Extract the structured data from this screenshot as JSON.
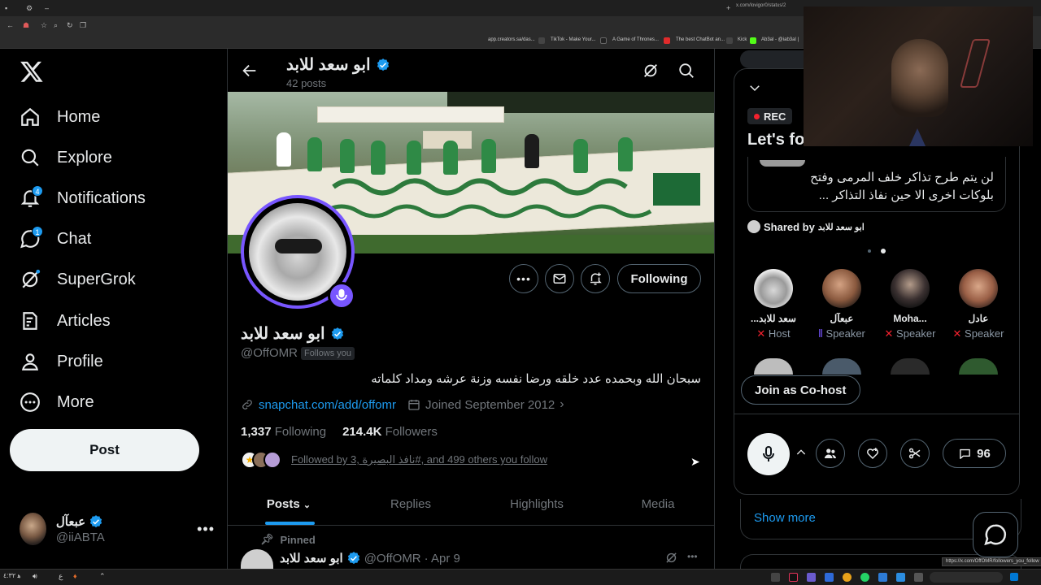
{
  "browser": {
    "url": "x.com/lovigor0/status/2",
    "status_url": "https://x.com/OffOMR/followers_you_follow",
    "bookmarks": [
      "app.creators.sa/das...",
      "TikTok - Make Your...",
      "A Game of Thrones...",
      "The best ChatBot an...",
      "Kick",
      "Ab3al - @iab3al |"
    ]
  },
  "nav": {
    "items": [
      {
        "label": "Home",
        "icon": "home-icon"
      },
      {
        "label": "Explore",
        "icon": "search-icon"
      },
      {
        "label": "Notifications",
        "icon": "bell-icon",
        "badge": "4"
      },
      {
        "label": "Chat",
        "icon": "chat-icon",
        "badge": "1"
      },
      {
        "label": "SuperGrok",
        "icon": "grok-icon"
      },
      {
        "label": "Articles",
        "icon": "article-icon"
      },
      {
        "label": "Profile",
        "icon": "person-icon"
      },
      {
        "label": "More",
        "icon": "more-icon"
      }
    ],
    "post_label": "Post",
    "account": {
      "name": "عبعآل",
      "handle": "@iiABTA"
    }
  },
  "header": {
    "name": "ابو سعد للابد",
    "posts_count": "42 posts"
  },
  "profile": {
    "name": "ابو سعد للابد",
    "handle": "@OffOMR",
    "follows_you": "Follows you",
    "bio": "سبحان الله وبحمده عدد خلقه ورضا نفسه وزنة عرشه ومداد كلماته",
    "link": "snapchat.com/add/offomr",
    "joined": "Joined September 2012",
    "following_count": "1,337",
    "following_label": "Following",
    "followers_count": "214.4K",
    "followers_label": "Followers",
    "followed_by": "Followed by 3, نافذ البصيرة#, and 499 others you follow",
    "following_button": "Following"
  },
  "tabs": [
    "Posts",
    "Replies",
    "Highlights",
    "Media"
  ],
  "pinned": {
    "label": "Pinned",
    "name": "ابو سعد للابد",
    "handle": "@OffOMR",
    "date": "· Apr 9"
  },
  "space": {
    "rec": "REC",
    "title": "Let's fo",
    "tweet_text_1": "لن يتم طرح تذاكر خلف المرمى وفتح",
    "tweet_text_2": "بلوكات اخرى الا حين نفاذ التذاكر ...",
    "shared_by_label": "Shared by",
    "shared_by_name": "ابو سعد للابد",
    "speakers": [
      {
        "name": "...سعد للابد",
        "role": "Host",
        "color": "#d6d6d6"
      },
      {
        "name": "عبعآل",
        "role": "Speaker",
        "color": "#b07a5c"
      },
      {
        "name": "Moha...",
        "role": "Speaker",
        "color": "#3a3030"
      },
      {
        "name": "عادل",
        "role": "Speaker",
        "color": "#9a5f46"
      }
    ],
    "join_label": "Join as Co-host",
    "comments_count": "96",
    "show_more": "Show more"
  },
  "colors": {
    "accent": "#1d9bf0",
    "space_purple": "#7856ff",
    "rec_red": "#f4212e"
  }
}
